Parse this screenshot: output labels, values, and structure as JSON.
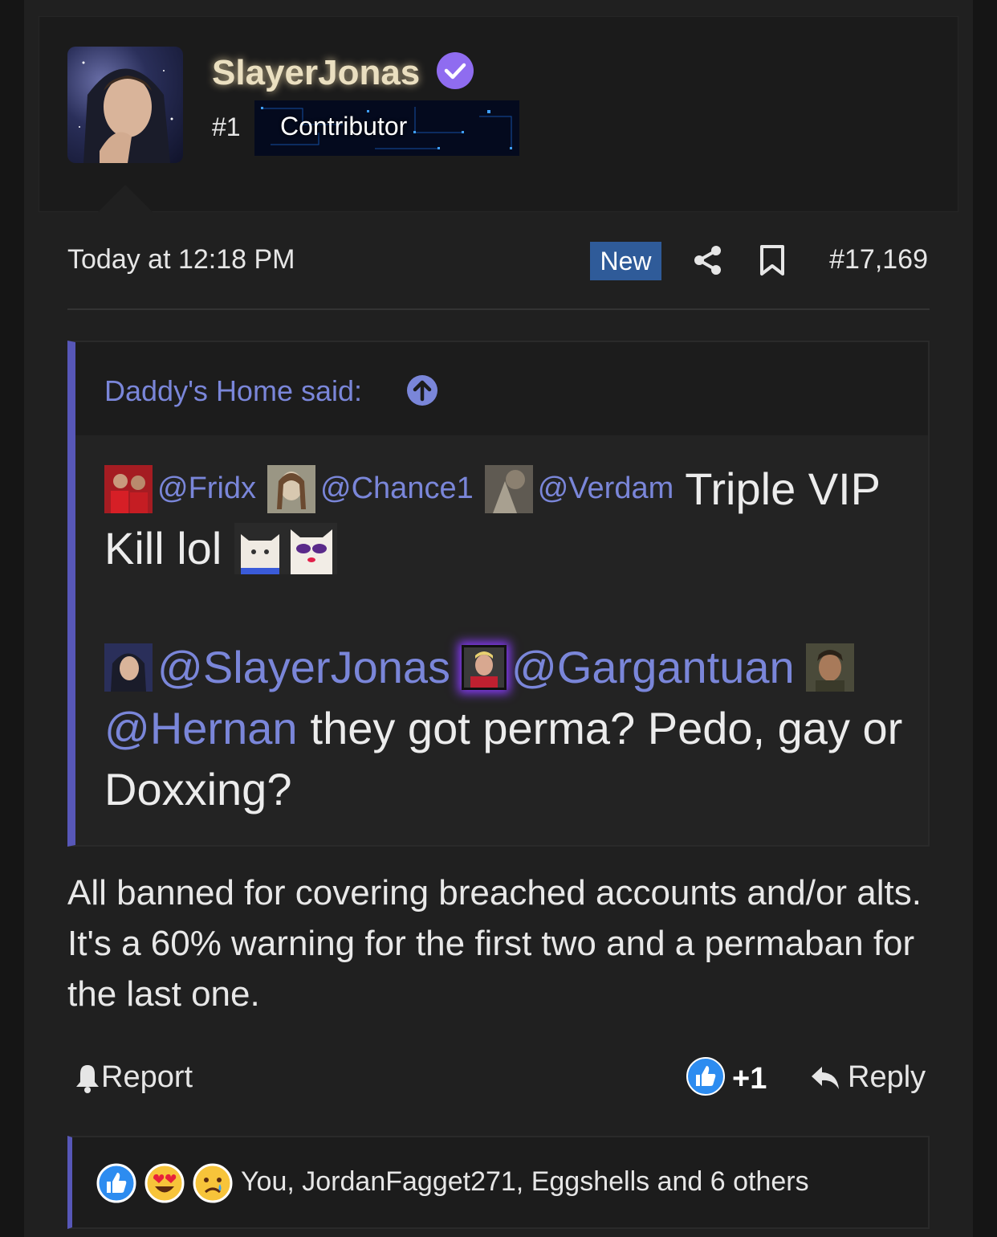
{
  "user": {
    "name": "SlayerJonas",
    "rank": "#1",
    "badge": "Contributor"
  },
  "post": {
    "time": "Today at 12:18 PM",
    "new_label": "New",
    "number": "#17,169"
  },
  "quote": {
    "author_label": "Daddy's Home said:",
    "line1_mentions": [
      "@Fridx",
      "@Chance1",
      "@Verdam"
    ],
    "line1_text": "Triple VIP",
    "line2_text": "Kill lol",
    "line3_mentions": [
      "@SlayerJonas",
      "@Gargantuan"
    ],
    "line4_mention": "@Hernan",
    "line4_text": "they got perma? Pedo, gay or",
    "line5_text": "Doxxing?"
  },
  "reply_text": "All banned for covering breached accounts and/or alts. It's a 60% warning for the first two and a permaban for the last one.",
  "actions": {
    "report": "Report",
    "like_count": "+1",
    "reply": "Reply"
  },
  "reactions": {
    "summary": "You, JordanFagget271, Eggshells and 6 others",
    "icons": [
      "like-icon",
      "love-icon",
      "sad-icon"
    ]
  },
  "colors": {
    "accent": "#5757b8",
    "mention": "#7a86d9",
    "new_badge": "#2f5b99",
    "verified": "#8f6cf0"
  }
}
